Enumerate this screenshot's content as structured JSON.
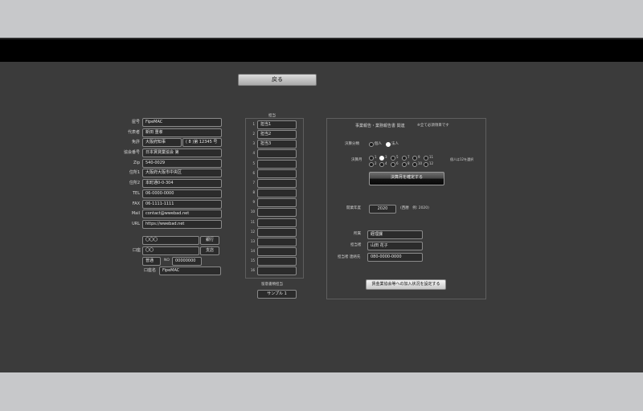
{
  "header": {
    "back_label": "戻る"
  },
  "company": {
    "labels": [
      "屋号",
      "代表者",
      "免許",
      "協会番号",
      "Zip",
      "住所1",
      "住所2",
      "TEL",
      "FAX",
      "Mail",
      "URL"
    ],
    "name": "FipeMAC",
    "representative": "新田 重孝",
    "license": "大阪府知事",
    "license_no": "( 8 )第 12345 号",
    "association_no": "日本賃貸業協会 第",
    "zip": "540-0029",
    "address1": "大阪府大阪市中央区",
    "address2": "本町通0-0-304",
    "tel": "06-0000-0000",
    "fax": "06-1111-1111",
    "mail": "contact@wwebad.net",
    "url": "https://wwebad.net"
  },
  "bank": {
    "label": "口座",
    "bank_name": "〇〇〇",
    "bank_btn": "銀行",
    "branch": "〇〇",
    "branch_btn": "支店",
    "type": "普通",
    "no_label": "NO",
    "account_no": "00000000",
    "holder_label": "口座名",
    "holder": "FipeMAC"
  },
  "middle": {
    "title": "担当",
    "numbers": [
      "1",
      "2",
      "3",
      "4",
      "5",
      "6",
      "7",
      "8",
      "9",
      "10",
      "11",
      "12",
      "13",
      "14",
      "15",
      "16"
    ],
    "staff": [
      "担当1",
      "担当2",
      "担当3",
      "",
      "",
      "",
      "",
      "",
      "",
      "",
      "",
      "",
      "",
      "",
      "",
      ""
    ],
    "sample_title": "留意書類担当",
    "sample_button": "サンプル 1"
  },
  "report": {
    "title": "事業報告・業務報告書 関連",
    "note": "※全て必須項目です",
    "type_label": "決算分類",
    "type_options": [
      "個人",
      "法人"
    ],
    "type_selected": 1,
    "month_label": "決算月",
    "months_row1": [
      "1",
      "3",
      "5",
      "7",
      "9",
      "11"
    ],
    "months_row2": [
      "2",
      "4",
      "6",
      "8",
      "10",
      "12"
    ],
    "month_selected": "3",
    "individual_note": "個人は12を選択",
    "confirm_button": "決算月を確定する",
    "year_label": "開業年度",
    "year_value": "2020",
    "year_hint": "(西暦　例: 2020)",
    "dept_label": "所属",
    "dept_value": "経理課",
    "person_label": "担当者",
    "person_value": "山田 花子",
    "contact_label": "担当者 連絡先",
    "contact_value": "080-0000-0000",
    "submit_button": "賃金業協会等への加入状況を設定する"
  }
}
